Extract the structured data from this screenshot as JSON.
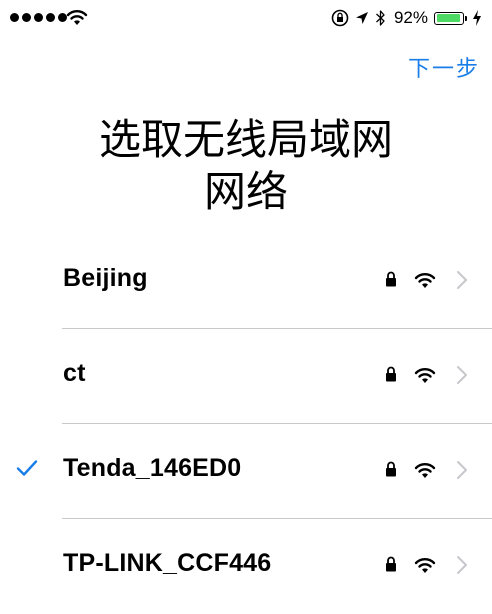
{
  "status_bar": {
    "battery_percent": "92%",
    "battery_level": 0.92,
    "battery_color": "#4cd964",
    "icons": [
      "signal-dots",
      "wifi-icon",
      "orientation-lock-icon",
      "location-icon",
      "bluetooth-icon",
      "battery-icon",
      "charging-icon"
    ]
  },
  "nav": {
    "next_label": "下一步",
    "accent_color": "#1a7ee8"
  },
  "title": {
    "line1": "选取无线局域网",
    "line2": "网络"
  },
  "networks": [
    {
      "name": "Beijing",
      "selected": false,
      "secured": true
    },
    {
      "name": "ct",
      "selected": false,
      "secured": true
    },
    {
      "name": "Tenda_146ED0",
      "selected": true,
      "secured": true
    },
    {
      "name": "TP-LINK_CCF446",
      "selected": false,
      "secured": true
    }
  ]
}
